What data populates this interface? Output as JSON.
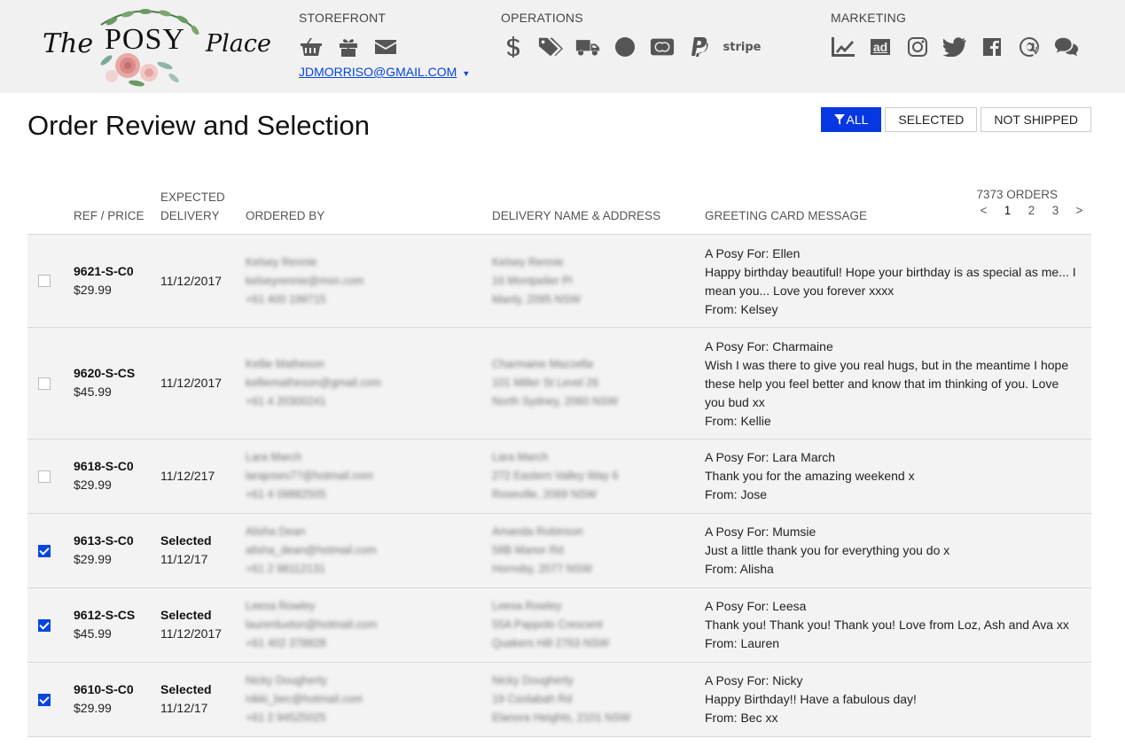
{
  "brand": {
    "the": "The",
    "posy": "POSY",
    "place": "Place"
  },
  "nav": {
    "storefront": {
      "title": "STOREFRONT",
      "icons": [
        "basket-icon",
        "gift-icon",
        "envelope-icon"
      ]
    },
    "operations": {
      "title": "OPERATIONS",
      "icons": [
        "dollar-icon",
        "tags-icon",
        "truck-icon",
        "circle-icon",
        "mastercard-icon",
        "paypal-icon",
        "stripe-icon"
      ],
      "stripe": "stripe"
    },
    "marketing": {
      "title": "MARKETING",
      "icons": [
        "chart-line-icon",
        "ad-icon",
        "instagram-icon",
        "twitter-icon",
        "facebook-icon",
        "at-icon",
        "comments-icon"
      ],
      "ad": "ad"
    },
    "account": "JDMORRISO@GMAIL.COM",
    "account_caret": "▼"
  },
  "page": {
    "title": "Order Review and Selection"
  },
  "filters": {
    "all": "ALL",
    "selected": "SELECTED",
    "not_shipped": "NOT SHIPPED"
  },
  "table": {
    "headers": {
      "ref": "REF / PRICE",
      "expected1": "EXPECTED",
      "expected2": "DELIVERY",
      "ordered_by": "ORDERED BY",
      "delivery": "DELIVERY NAME & ADDRESS",
      "message": "GREETING CARD MESSAGE"
    },
    "count": "7373 ORDERS",
    "pager": {
      "prev": "<",
      "p1": "1",
      "p2": "2",
      "p3": "3",
      "next": ">"
    },
    "rows": [
      {
        "checked": false,
        "ref": "9621-S-C0",
        "price": "$29.99",
        "selected": "",
        "date": "11/12/2017",
        "ordered": [
          "Kelsey Rennie",
          "kelseyrennie@msn.com",
          "+61 400 199715"
        ],
        "address": [
          "Kelsey Rennie",
          "16 Montpelier Pl",
          "Manly, 2095 NSW"
        ],
        "for": "A Posy For: Ellen",
        "text": "Happy birthday beautiful! Hope your birthday is as special as me... I mean you... Love you forever xxxx",
        "from": "From: Kelsey"
      },
      {
        "checked": false,
        "ref": "9620-S-CS",
        "price": "$45.99",
        "selected": "",
        "date": "11/12/2017",
        "ordered": [
          "Kellie Matheson",
          "kelliematheson@gmail.com",
          "+61 4 20300241"
        ],
        "address": [
          "Charmaine Mazzella",
          "101 Miller St Level 26",
          "North Sydney, 2060 NSW"
        ],
        "for": "A Posy For: Charmaine",
        "text": "Wish I was there to give you real hugs, but in the meantime I hope these help you feel better and know that im thinking of you. Love you bud xx",
        "from": "From: Kellie"
      },
      {
        "checked": false,
        "ref": "9618-S-C0",
        "price": "$29.99",
        "selected": "",
        "date": "11/12/217",
        "ordered": [
          "Lara March",
          "larajoses77@hotmail.com",
          "+61 4 09882505"
        ],
        "address": [
          "Lara March",
          "272 Eastern Valley Way 6",
          "Roseville, 2069 NSW"
        ],
        "for": "A Posy For: Lara March",
        "text": "Thank you for the amazing weekend x",
        "from": "From: Jose"
      },
      {
        "checked": true,
        "ref": "9613-S-C0",
        "price": "$29.99",
        "selected": "Selected",
        "date": "11/12/17",
        "ordered": [
          "Alisha Dean",
          "alisha_dean@hotmail.com",
          "+61 2 98112131"
        ],
        "address": [
          "Amanda Robinson",
          "58B Manor Rd",
          "Hornsby, 2077 NSW"
        ],
        "for": "A Posy For: Mumsie",
        "text": "Just a little thank you for everything you do x",
        "from": "From: Alisha"
      },
      {
        "checked": true,
        "ref": "9612-S-CS",
        "price": "$45.99",
        "selected": "Selected",
        "date": "11/12/2017",
        "ordered": [
          "Leesa Rowley",
          "laurenluxton@hotmail.com",
          "+61 402 378828"
        ],
        "address": [
          "Leesa Rowley",
          "55A Pappolo Crescent",
          "Quakers Hill 2763 NSW"
        ],
        "for": "A Posy For: Leesa",
        "text": "Thank you! Thank you! Thank you! Love from Loz, Ash and Ava xx",
        "from": "From: Lauren"
      },
      {
        "checked": true,
        "ref": "9610-S-C0",
        "price": "$29.99",
        "selected": "Selected",
        "date": "11/12/17",
        "ordered": [
          "Nicky Dougherty",
          "nikki_bec@hotmail.com",
          "+61 2 94525025"
        ],
        "address": [
          "Nicky Dougherty",
          "19 Coolabah Rd",
          "Elanora Heights, 2101 NSW"
        ],
        "for": "A Posy For: Nicky",
        "text": "Happy Birthday!! Have a fabulous day!",
        "from": "From: Bec xx"
      }
    ]
  },
  "colors": {
    "accent": "#0637e0",
    "link": "#0645e0",
    "header_bg": "#f1f1f1",
    "row_bg": "#f3f3f3"
  }
}
